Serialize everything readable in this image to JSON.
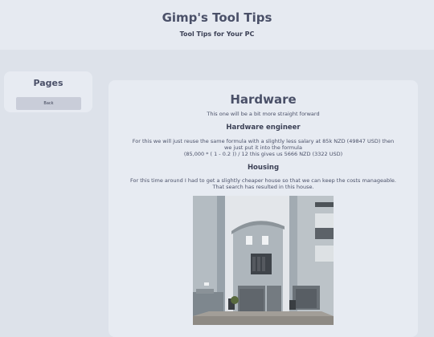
{
  "header": {
    "title": "Gimp's Tool Tips",
    "subtitle": "Tool Tips for Your PC"
  },
  "sidebar": {
    "title": "Pages",
    "back_label": "Back"
  },
  "main": {
    "title": "Hardware",
    "intro": "This one will be a bit more straight forward",
    "engineer_heading": "Hardware engineer",
    "engineer_line1": "For this we will just reuse the same formula with a slightly less salary at 85k NZD (49847 USD) then",
    "engineer_line2": "we just put it into the formula",
    "engineer_line3": "(85,000 * ( 1 - 0.2 )) / 12 this gives us 5666 NZD (3322 USD)",
    "housing_heading": "Housing",
    "housing_line1": "For this time around I had to get a slightly cheaper house so that we can keep the costs manageable.",
    "housing_line2": "That search has resulted in this house."
  },
  "colors": {
    "page_bg": "#dde2ea",
    "panel_bg": "#e7ebf2",
    "text": "#4a5068",
    "button": "#c9cdd9"
  }
}
